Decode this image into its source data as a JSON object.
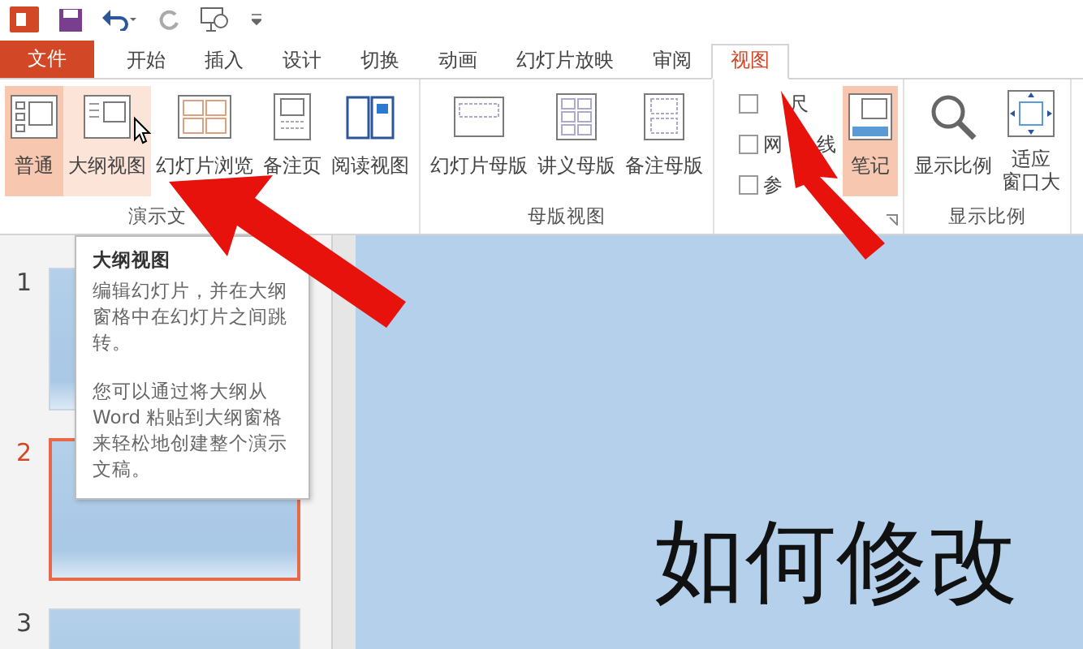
{
  "tabs": [
    {
      "label": "文件",
      "kind": "file",
      "selected": false
    },
    {
      "label": "开始",
      "kind": "tab",
      "selected": false
    },
    {
      "label": "插入",
      "kind": "tab",
      "selected": false
    },
    {
      "label": "设计",
      "kind": "tab",
      "selected": false
    },
    {
      "label": "切换",
      "kind": "tab",
      "selected": false
    },
    {
      "label": "动画",
      "kind": "tab",
      "selected": false
    },
    {
      "label": "幻灯片放映",
      "kind": "tab",
      "selected": false
    },
    {
      "label": "审阅",
      "kind": "tab",
      "selected": false
    },
    {
      "label": "视图",
      "kind": "tab",
      "selected": true
    }
  ],
  "ribbon": {
    "groups": [
      {
        "label": "演示文",
        "items": [
          {
            "kind": "button",
            "lines": [
              "普通"
            ],
            "selected": true
          },
          {
            "kind": "button",
            "lines": [
              "大纲视图"
            ],
            "selected": false,
            "hovered": true
          },
          {
            "kind": "button",
            "lines": [
              "幻灯片浏览"
            ],
            "selected": false
          },
          {
            "kind": "button",
            "lines": [
              "备注页"
            ],
            "selected": false
          },
          {
            "kind": "button",
            "lines": [
              "阅读视图"
            ],
            "selected": false
          }
        ]
      },
      {
        "label": "母版视图",
        "items": [
          {
            "kind": "button",
            "lines": [
              "幻灯片母版"
            ],
            "selected": false
          },
          {
            "kind": "button",
            "lines": [
              "讲义母版"
            ],
            "selected": false
          },
          {
            "kind": "button",
            "lines": [
              "备注母版"
            ],
            "selected": false
          }
        ]
      },
      {
        "launcher": true,
        "items": [
          {
            "kind": "checks",
            "boxes": [
              {
                "parts": [
                  "尺"
                ],
                "checked": false
              },
              {
                "parts": [
                  "网",
                  "线"
                ],
                "checked": false
              },
              {
                "parts": [
                  "参"
                ],
                "checked": false
              }
            ]
          },
          {
            "kind": "button",
            "lines": [
              "笔记"
            ],
            "selected": true
          }
        ]
      },
      {
        "label": "显示比例",
        "items": [
          {
            "kind": "button",
            "lines": [
              "显示比例"
            ],
            "selected": false
          },
          {
            "kind": "button",
            "lines": [
              "适应",
              "窗口大"
            ],
            "selected": false
          }
        ]
      }
    ]
  },
  "tooltip": {
    "title": "大纲视图",
    "paragraphs": [
      "编辑幻灯片，并在大纲窗格中在幻灯片之间跳转。",
      "您可以通过将大纲从 Word 粘贴到大纲窗格来轻松地创建整个演示文稿。"
    ]
  },
  "thumbnails": [
    {
      "number": "1",
      "selected": false
    },
    {
      "number": "2",
      "selected": true
    },
    {
      "number": "3",
      "selected": false
    }
  ],
  "slide": {
    "title": "如何修改"
  }
}
